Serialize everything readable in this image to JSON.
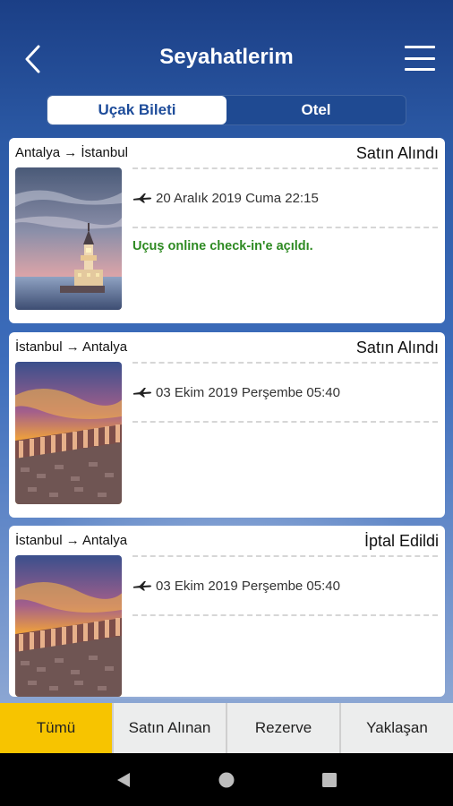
{
  "header": {
    "title": "Seyahatlerim"
  },
  "tabs": [
    {
      "label": "Uçak Bileti",
      "active": true
    },
    {
      "label": "Otel",
      "active": false
    }
  ],
  "trips": [
    {
      "route": "Antalya → İstanbul",
      "status": "Satın Alındı",
      "flight": "20 Aralık 2019 Cuma 22:15",
      "note": "Uçuş online check-in'e açıldı.",
      "image": "maidens-tower"
    },
    {
      "route": "İstanbul → Antalya",
      "status": "Satın Alındı",
      "flight": "03 Ekim 2019 Perşembe 05:40",
      "note": "",
      "image": "antalya-colonnade"
    },
    {
      "route": "İstanbul → Antalya",
      "status": "İptal Edildi",
      "flight": "03 Ekim 2019 Perşembe 05:40",
      "note": "",
      "image": "antalya-colonnade"
    }
  ],
  "bottom_tabs": [
    {
      "label": "Tümü",
      "active": true
    },
    {
      "label": "Satın Alınan",
      "active": false
    },
    {
      "label": "Rezerve",
      "active": false
    },
    {
      "label": "Yaklaşan",
      "active": false
    }
  ],
  "colors": {
    "accent_yellow": "#f7c400",
    "note_green": "#2e8a22",
    "tab_blue": "#1e4c9a"
  },
  "icons": {
    "back": "chevron-left-icon",
    "menu": "hamburger-menu-icon",
    "flight": "airplane-icon",
    "nav_back": "triangle-back-icon",
    "nav_home": "circle-home-icon",
    "nav_recents": "square-recents-icon"
  }
}
